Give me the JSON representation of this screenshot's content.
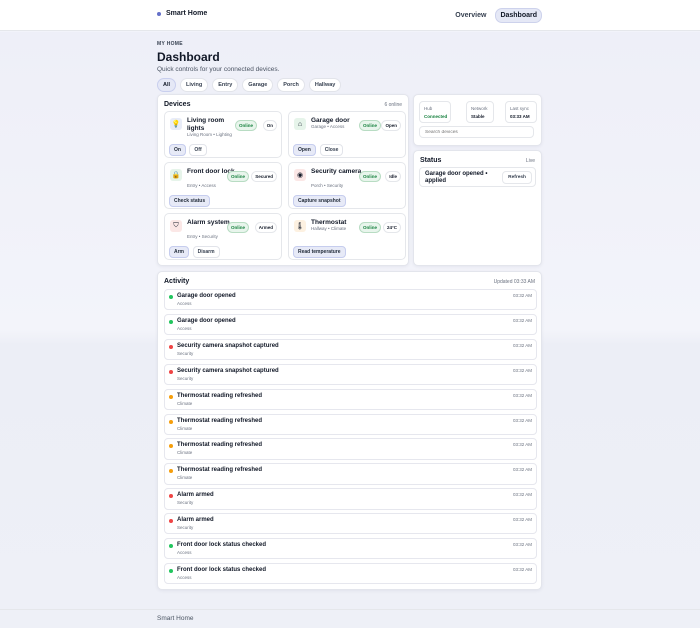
{
  "topbar": {
    "brand": "Smart Home",
    "nav": [
      {
        "label": "Overview",
        "active": false
      },
      {
        "label": "Dashboard",
        "active": true
      }
    ]
  },
  "header": {
    "eyebrow": "MY HOME",
    "title": "Dashboard",
    "subtitle": "Quick controls for your connected devices.",
    "filters": [
      {
        "label": "All",
        "active": true
      },
      {
        "label": "Living",
        "active": false
      },
      {
        "label": "Entry",
        "active": false
      },
      {
        "label": "Garage",
        "active": false
      },
      {
        "label": "Porch",
        "active": false
      },
      {
        "label": "Hallway",
        "active": false
      }
    ]
  },
  "devices": {
    "title": "Devices",
    "count_label": "6 online",
    "items": [
      {
        "name": "Living room lights",
        "sub": "Living Room • Lighting",
        "online": "Online",
        "state": "On",
        "icon": "lightbulb-icon",
        "icon_char": "💡",
        "icon_bg": "#e8ecf8",
        "buttons": [
          {
            "label": "On",
            "primary": true
          },
          {
            "label": "Off",
            "primary": false
          }
        ]
      },
      {
        "name": "Garage door",
        "sub": "Garage • Access",
        "online": "Online",
        "state": "Open",
        "icon": "garage-icon",
        "icon_char": "⌂",
        "icon_bg": "#e6f4ea",
        "buttons": [
          {
            "label": "Open",
            "primary": true
          },
          {
            "label": "Close",
            "primary": false
          }
        ]
      },
      {
        "name": "Front door lock",
        "sub": "Entry • Access",
        "online": "Online",
        "state": "Secured",
        "icon": "lock-icon",
        "icon_char": "🔒",
        "icon_bg": "#e6f4ea",
        "buttons": [
          {
            "label": "Check status",
            "primary": true
          }
        ]
      },
      {
        "name": "Security camera",
        "sub": "Porch • Security",
        "online": "Online",
        "state": "Idle",
        "icon": "eye-icon",
        "icon_char": "◉",
        "icon_bg": "#fbe7e6",
        "buttons": [
          {
            "label": "Capture snapshot",
            "primary": true
          }
        ]
      },
      {
        "name": "Alarm system",
        "sub": "Entry • Security",
        "online": "Online",
        "state": "Armed",
        "icon": "shield-icon",
        "icon_char": "⛉",
        "icon_bg": "#fbe7e6",
        "buttons": [
          {
            "label": "Arm",
            "primary": true
          },
          {
            "label": "Disarm",
            "primary": false
          }
        ]
      },
      {
        "name": "Thermostat",
        "sub": "Hallway • Climate",
        "online": "Online",
        "state": "24°C",
        "icon": "thermometer-icon",
        "icon_char": "🌡",
        "icon_bg": "#fdf1e1",
        "buttons": [
          {
            "label": "Read temperature",
            "primary": true
          }
        ]
      }
    ]
  },
  "hub": {
    "stats": [
      {
        "label": "Hub",
        "value": "Connected",
        "color": "#15803d"
      },
      {
        "label": "Network",
        "value": "Stable",
        "color": "#111827"
      },
      {
        "label": "Last sync",
        "value": "03:33 AM",
        "color": "#111827"
      }
    ],
    "search_placeholder": "Search devices"
  },
  "status": {
    "title": "Status",
    "meta": "Live",
    "message": "Garage door opened • applied",
    "refresh_label": "Refresh"
  },
  "activity": {
    "title": "Activity",
    "updated": "Updated 03:33 AM",
    "items": [
      {
        "title": "Garage door opened",
        "sub": "Access",
        "time": "03:32 AM",
        "color": "#22c55e"
      },
      {
        "title": "Garage door opened",
        "sub": "Access",
        "time": "03:32 AM",
        "color": "#22c55e"
      },
      {
        "title": "Security camera snapshot captured",
        "sub": "Security",
        "time": "03:32 AM",
        "color": "#ef4444"
      },
      {
        "title": "Security camera snapshot captured",
        "sub": "Security",
        "time": "03:32 AM",
        "color": "#ef4444"
      },
      {
        "title": "Thermostat reading refreshed",
        "sub": "Climate",
        "time": "03:32 AM",
        "color": "#f59e0b"
      },
      {
        "title": "Thermostat reading refreshed",
        "sub": "Climate",
        "time": "03:32 AM",
        "color": "#f59e0b"
      },
      {
        "title": "Thermostat reading refreshed",
        "sub": "Climate",
        "time": "03:32 AM",
        "color": "#f59e0b"
      },
      {
        "title": "Thermostat reading refreshed",
        "sub": "Climate",
        "time": "03:32 AM",
        "color": "#f59e0b"
      },
      {
        "title": "Alarm armed",
        "sub": "Security",
        "time": "03:32 AM",
        "color": "#ef4444"
      },
      {
        "title": "Alarm armed",
        "sub": "Security",
        "time": "03:32 AM",
        "color": "#ef4444"
      },
      {
        "title": "Front door lock status checked",
        "sub": "Access",
        "time": "03:32 AM",
        "color": "#22c55e"
      },
      {
        "title": "Front door lock status checked",
        "sub": "Access",
        "time": "03:32 AM",
        "color": "#22c55e"
      }
    ]
  },
  "footer": {
    "text": "Smart Home"
  }
}
